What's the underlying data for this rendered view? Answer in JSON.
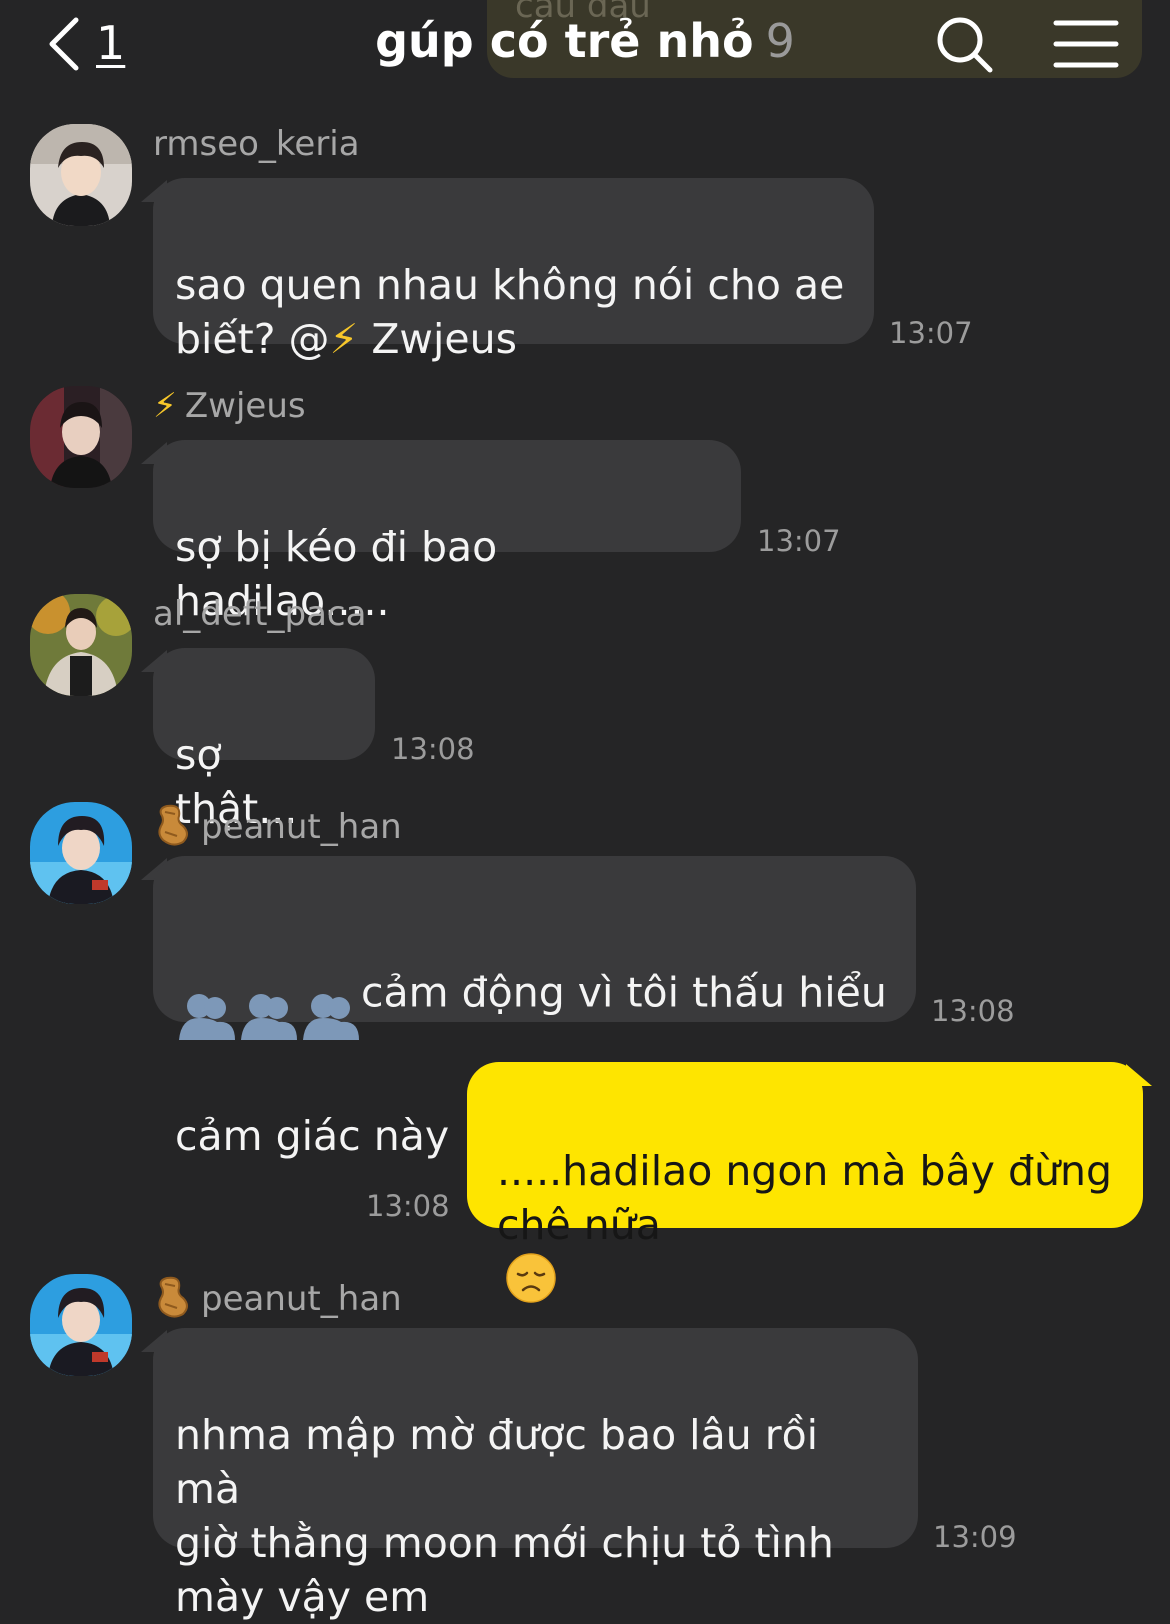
{
  "header": {
    "back_count": "1",
    "title": "gúp có trẻ nhỏ",
    "member_count": "9",
    "overlay_text": "câu đầu"
  },
  "colors": {
    "background": "#252526",
    "bubble_incoming": "#3a3a3c",
    "bubble_outgoing": "#fee500"
  },
  "messages": [
    {
      "sender": "rmseo_keria",
      "sender_badge": "",
      "avatar": "avatar-photo",
      "text_before_mention": "sao quen nhau không nói cho ae\nbiết? @",
      "mention_icon": "⚡",
      "text_after_mention": " Zwjeus",
      "time": "13:07"
    },
    {
      "sender": "Zwjeus",
      "sender_badge": "⚡",
      "avatar": "avatar-photo",
      "text": "sợ bị kéo đi bao hadilao.....",
      "time": "13:07"
    },
    {
      "sender": "al_deft_paca",
      "sender_badge": "",
      "avatar": "avatar-photo",
      "text": "sợ thật...",
      "time": "13:08"
    },
    {
      "sender": "peanut_han",
      "sender_badge": "peanut-icon",
      "avatar": "avatar-photo",
      "emoji": "hug-emoji",
      "text_line1": "cảm động vì tôi thấu hiểu",
      "text_line2": "cảm giác này",
      "time": "13:08"
    },
    {
      "outgoing": true,
      "text": ".....hadilao ngon mà bây đừng\nchê nữa",
      "emoji": "disappointed-face-emoji",
      "time": "13:08"
    },
    {
      "sender": "peanut_han",
      "sender_badge": "peanut-icon",
      "avatar": "avatar-photo",
      "text": "nhma mập mờ được bao lâu rồi mà\ngiờ thằng moon mới chịu tỏ tình\nmày vậy em",
      "time": "13:09"
    }
  ]
}
